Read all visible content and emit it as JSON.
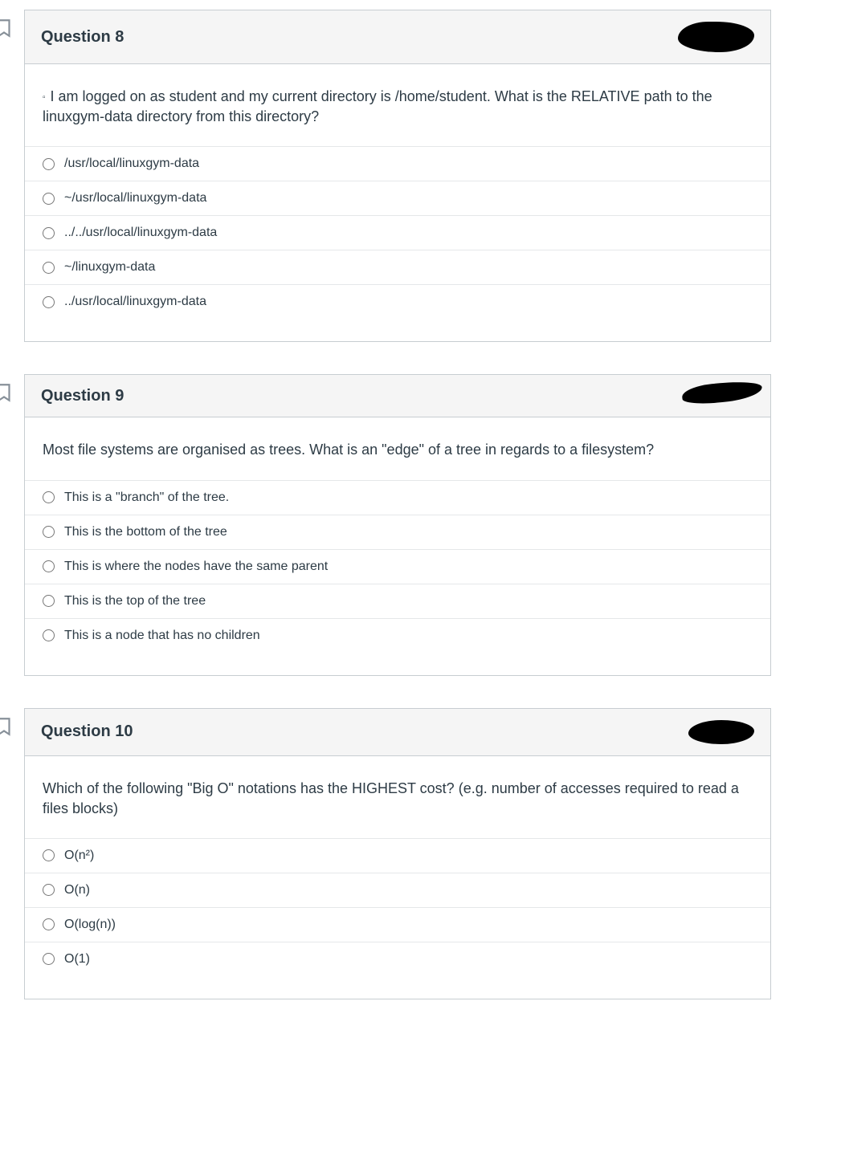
{
  "questions": [
    {
      "title": "Question 8",
      "prompt_prefix": "▫",
      "prompt": "I am logged on as student and my current directory is /home/student. What is the RELATIVE path to the linuxgym-data directory from this directory?",
      "options": [
        "/usr/local/linuxgym-data",
        "~/usr/local/linuxgym-data",
        "../../usr/local/linuxgym-data",
        "~/linuxgym-data",
        "../usr/local/linuxgym-data"
      ]
    },
    {
      "title": "Question 9",
      "prompt": "Most file systems are organised as trees. What is an \"edge\" of a tree in regards to a filesystem?",
      "options": [
        "This is a \"branch\" of the tree.",
        "This is the bottom of the tree",
        "This is where the nodes have the same parent",
        "This is the top of the tree",
        "This is a node that has no children"
      ]
    },
    {
      "title": "Question 10",
      "prompt": "Which of the following \"Big O\" notations has the HIGHEST cost? (e.g. number of accesses required to read a files blocks)",
      "options": [
        "O(n²)",
        "O(n)",
        "O(log(n))",
        "O(1)"
      ]
    }
  ]
}
